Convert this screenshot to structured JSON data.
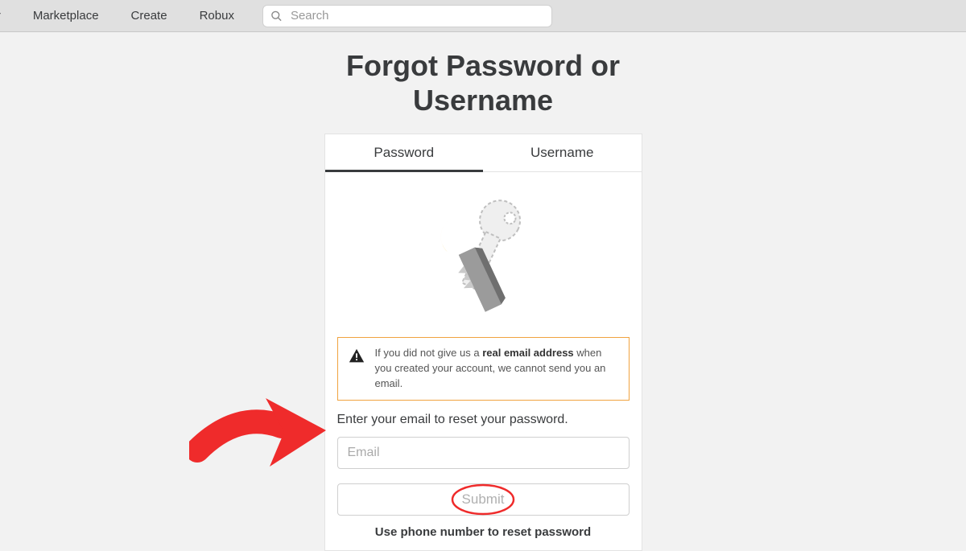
{
  "nav": {
    "items": [
      "ver",
      "Marketplace",
      "Create",
      "Robux"
    ]
  },
  "search": {
    "placeholder": "Search"
  },
  "page": {
    "title_line1": "Forgot Password or",
    "title_line2": "Username"
  },
  "tabs": {
    "password": "Password",
    "username": "Username"
  },
  "warning": {
    "prefix": "If you did not give us a ",
    "bold": "real email address",
    "suffix": " when you created your account, we cannot send you an email."
  },
  "form": {
    "instruction": "Enter your email to reset your password.",
    "email_placeholder": "Email",
    "submit_label": "Submit",
    "phone_link": "Use phone number to reset password"
  }
}
